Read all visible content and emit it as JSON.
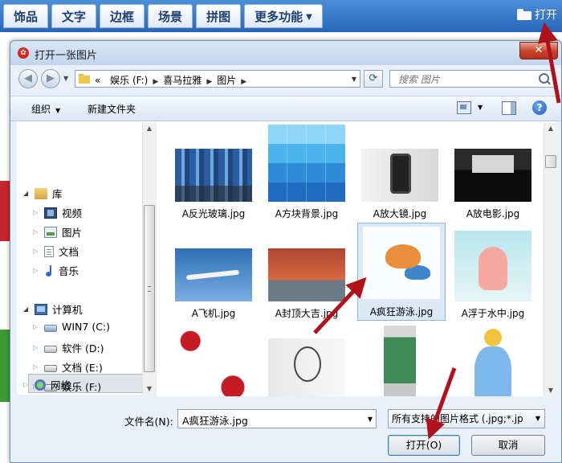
{
  "app": {
    "tabs": [
      "饰品",
      "文字",
      "边框",
      "场景",
      "拼图",
      "更多功能"
    ],
    "open_label": "打开"
  },
  "dialog": {
    "title": "打开一张图片",
    "close_symbol": "✕",
    "address": {
      "overflow_symbol": "«",
      "crumbs": [
        "娱乐 (F:)",
        "喜马拉雅",
        "图片"
      ]
    },
    "search_placeholder": "搜索 图片",
    "toolbar": {
      "organize_label": "组织",
      "new_folder_label": "新建文件夹",
      "help_symbol": "?"
    },
    "nav": {
      "library": "库",
      "videos": "视频",
      "pictures": "图片",
      "documents": "文档",
      "music": "音乐",
      "computer": "计算机",
      "drive_c": "WIN7 (C:)",
      "drive_d": "软件 (D:)",
      "drive_e": "文档 (E:)",
      "drive_f": "娱乐 (F:)",
      "network": "网络"
    },
    "files": [
      {
        "name": "A反光玻璃.jpg"
      },
      {
        "name": "A方块背景.jpg"
      },
      {
        "name": "A放大镜.jpg"
      },
      {
        "name": "A放电影.jpg"
      },
      {
        "name": "A飞机.jpg"
      },
      {
        "name": "A封顶大吉.jpg"
      },
      {
        "name": "A疯狂游泳.jpg",
        "selected": true
      },
      {
        "name": "A浮于水中.jpg"
      }
    ],
    "filename_label": "文件名(N):",
    "filename_value": "A疯狂游泳.jpg",
    "filetype_value": "所有支持的图片格式 (.jpg;*.jp",
    "open_button": "打开(O)",
    "cancel_button": "取消"
  },
  "colors": {
    "toolbar_blue": "#2766b8",
    "annotation_arrow": "#b0111b",
    "selection": "#dbe8f8"
  }
}
